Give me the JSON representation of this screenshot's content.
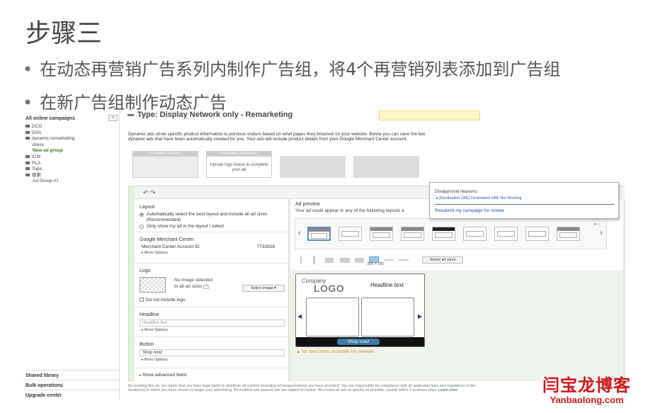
{
  "slide": {
    "title": "步骤三",
    "bullets": [
      "在动态再营销广告系列内制作广告组，将4个再营销列表添加到广告组",
      "在新广告组制作动态广告"
    ]
  },
  "nav": {
    "header": "All online campaigns",
    "collapse_label": "«",
    "items": [
      {
        "label": "DCO",
        "indent": false,
        "active": false
      },
      {
        "label": "DSA",
        "indent": false,
        "active": false
      },
      {
        "label": "dynamic remarketing",
        "indent": false,
        "active": false
      },
      {
        "label": "dress",
        "indent": true,
        "active": false
      },
      {
        "label": "New ad group",
        "indent": true,
        "active": true
      },
      {
        "label": "ICM",
        "indent": false,
        "active": false
      },
      {
        "label": "PLA",
        "indent": false,
        "active": false
      },
      {
        "label": "Topic",
        "indent": false,
        "active": false
      },
      {
        "label": "搜索",
        "indent": false,
        "active": false
      },
      {
        "label": "Ad Group #1",
        "indent": true,
        "active": false
      }
    ],
    "bottom": [
      "Shared library",
      "Bulk operations",
      "Upgrade center"
    ]
  },
  "campaign": {
    "type_line": "Type:  Display Network only - Remarketing",
    "description": "Dynamic ads show specific product information to previous visitors based on what pages they browsed on your website. Below you can save the two dynamic ads that have been automatically created for you. Your ads will include product details from your Google Merchant Center account.",
    "cards": [
      {
        "caption": "DYNAMIC (TEXT)",
        "body": ""
      },
      {
        "caption": "DYNAMIC (DISPLAY)",
        "body": "Upload logo below to complete your ad"
      }
    ]
  },
  "editor": {
    "undo_icons": "↶  ↷",
    "layout": {
      "title": "Layout",
      "options": [
        {
          "label": "Automatically select the best layout and include all ad sizes (Recommended)",
          "selected": true
        },
        {
          "label": "Only show my ad in the layout I select",
          "selected": false
        }
      ]
    },
    "merchant": {
      "title": "Google Merchant Center",
      "account_label": "Merchant Center Account ID",
      "account_id": "7732826",
      "more": "More Options"
    },
    "logo": {
      "title": "Logo",
      "status": "No image selected.",
      "sizes_label": "In all ad sizes",
      "help": "?",
      "select_button": "Select image ▾",
      "no_logo_label": "Do not include logo"
    },
    "headline": {
      "title": "Headline",
      "placeholder": "Headline text",
      "more": "More Options"
    },
    "button": {
      "title": "Button",
      "value": "Shop now!",
      "more": "More Options"
    },
    "advanced": "Show advanced fields"
  },
  "preview": {
    "title": "Ad preview",
    "subtitle": "Your ad could appear in any of the following layouts a",
    "size_label": "300 × 250",
    "select_sizes_button": "Select ad sizes",
    "mock": {
      "company": "Company",
      "logo": "LOGO",
      "headline": "Headline text",
      "shop_button": "Shop now!"
    },
    "warning": "No feed items available for preview."
  },
  "popup": {
    "title": "Disapproval reasons:",
    "item": "[Destination URL] Destination URL Not Working",
    "link": "Resubmit my campaign for review"
  },
  "legal": {
    "text": "By creating this ad, you agree that you have legal rights to distribute all content (including all images/videos) you have provided. You are responsible for compliance with all applicable laws and regulations in the location(s) in which you have chosen to target your advertising. All enabled and paused ads are subject to review. We review all ads as quickly as possible, usually within 1 business days.",
    "link": "Learn more"
  },
  "watermark": {
    "cn": "闫宝龙博客",
    "en": "Yanbaolong.com"
  },
  "colors": {
    "accent_green": "#3a7a1b",
    "link_blue": "#2b4fb0",
    "watermark_red": "#d4161e",
    "warning_orange": "#d2931a"
  }
}
